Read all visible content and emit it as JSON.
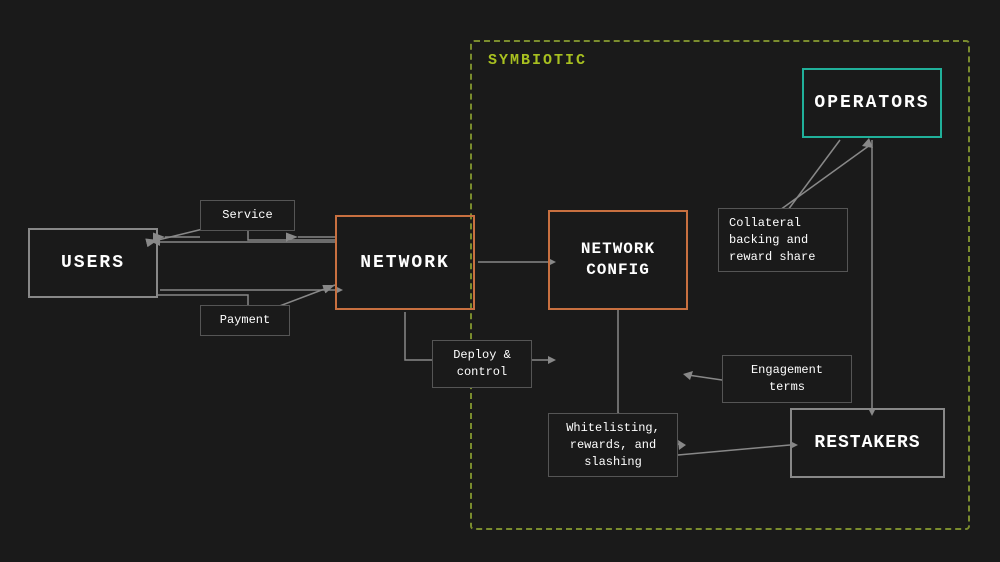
{
  "diagram": {
    "symbiotic_label": "SYMBIOTIC",
    "boxes": {
      "users": "USERS",
      "network": "NETWORK",
      "network_config": "NETWORK\nCONFIG",
      "operators": "OPERATORS",
      "restakers": "RESTAKERS"
    },
    "labels": {
      "service": "Service",
      "payment": "Payment",
      "deploy_control": "Deploy &\ncontrol",
      "collateral": "Collateral backing\nand reward share",
      "engagement": "Engagement terms",
      "whitelisting": "Whitelisting,\nrewards, and\nslashing"
    }
  }
}
